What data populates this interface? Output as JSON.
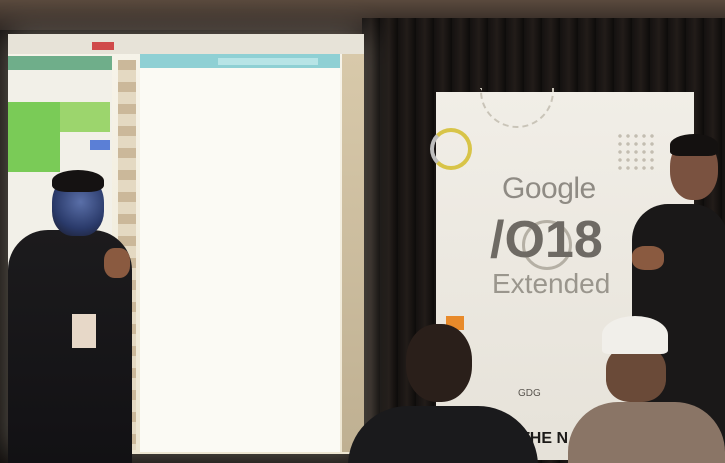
{
  "photo": {
    "description_free": true,
    "banner": {
      "google": "Google",
      "io": "/O18",
      "extended": "Extended",
      "sub": "",
      "gdg": "GDG",
      "the": "THE N"
    },
    "colors": {
      "banner_bg": "#ece8e0",
      "projection": "#f6f2e6",
      "accent_yellow": "#d8c448",
      "accent_green": "#7acb57",
      "accent_blue": "#5b7fd6",
      "accent_orange": "#e88a2a"
    }
  }
}
